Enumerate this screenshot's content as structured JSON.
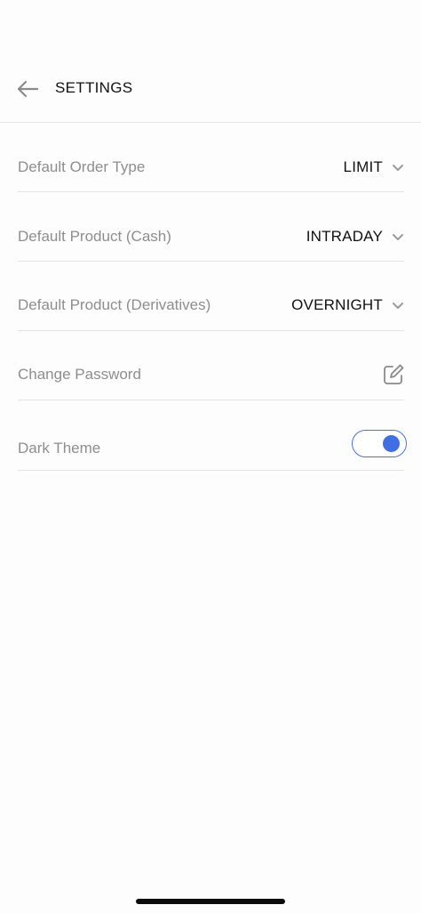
{
  "header": {
    "title": "SETTINGS",
    "back_icon": "arrow-left-icon"
  },
  "settings": {
    "order_type": {
      "label": "Default Order Type",
      "value": "LIMIT"
    },
    "product_cash": {
      "label": "Default Product (Cash)",
      "value": "INTRADAY"
    },
    "product_derivatives": {
      "label": "Default Product (Derivatives)",
      "value": "OVERNIGHT"
    },
    "change_password": {
      "label": "Change Password",
      "icon": "edit-icon"
    },
    "dark_theme": {
      "label": "Dark Theme",
      "enabled": true
    }
  },
  "colors": {
    "accent": "#3f6fe3",
    "label_gray": "#8e8e8e",
    "divider": "#e4e4e4"
  }
}
